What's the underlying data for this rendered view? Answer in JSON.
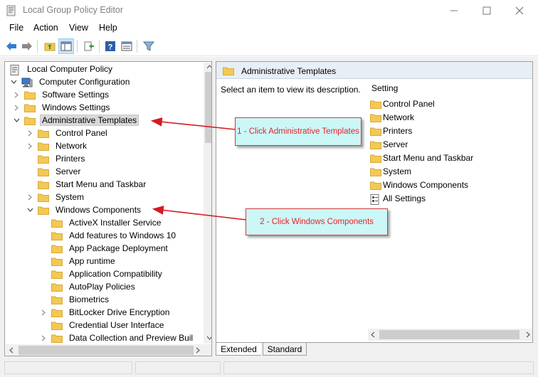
{
  "window": {
    "title": "Local Group Policy Editor",
    "minimize_glyph": "—",
    "maximize_glyph": "☐",
    "close_glyph": "✕"
  },
  "menu": [
    "File",
    "Action",
    "View",
    "Help"
  ],
  "toolbar": {
    "icons": [
      "back-arrow-icon",
      "forward-arrow-icon",
      "up-folder-icon",
      "show-hide-tree-icon",
      "export-list-icon",
      "help-icon",
      "properties-icon",
      "filter-icon"
    ]
  },
  "tree": {
    "items": [
      {
        "label": "Local Computer Policy",
        "level": 0,
        "expander": "",
        "icon": "policy-icon"
      },
      {
        "label": "Computer Configuration",
        "level": 0,
        "expander": "open",
        "icon": "computer-icon"
      },
      {
        "label": "Software Settings",
        "level": 1,
        "expander": "closed",
        "icon": "folder-icon"
      },
      {
        "label": "Windows Settings",
        "level": 1,
        "expander": "closed",
        "icon": "folder-icon"
      },
      {
        "label": "Administrative Templates",
        "level": 1,
        "expander": "open",
        "icon": "folder-icon",
        "selected": true
      },
      {
        "label": "Control Panel",
        "level": 2,
        "expander": "closed",
        "icon": "folder-icon"
      },
      {
        "label": "Network",
        "level": 2,
        "expander": "closed",
        "icon": "folder-icon"
      },
      {
        "label": "Printers",
        "level": 2,
        "expander": "",
        "icon": "folder-icon"
      },
      {
        "label": "Server",
        "level": 2,
        "expander": "",
        "icon": "folder-icon"
      },
      {
        "label": "Start Menu and Taskbar",
        "level": 2,
        "expander": "",
        "icon": "folder-icon"
      },
      {
        "label": "System",
        "level": 2,
        "expander": "closed",
        "icon": "folder-icon"
      },
      {
        "label": "Windows Components",
        "level": 2,
        "expander": "open",
        "icon": "folder-icon"
      },
      {
        "label": "ActiveX Installer Service",
        "level": 3,
        "expander": "",
        "icon": "folder-icon"
      },
      {
        "label": "Add features to Windows 10",
        "level": 3,
        "expander": "",
        "icon": "folder-icon"
      },
      {
        "label": "App Package Deployment",
        "level": 3,
        "expander": "",
        "icon": "folder-icon"
      },
      {
        "label": "App runtime",
        "level": 3,
        "expander": "",
        "icon": "folder-icon"
      },
      {
        "label": "Application Compatibility",
        "level": 3,
        "expander": "",
        "icon": "folder-icon"
      },
      {
        "label": "AutoPlay Policies",
        "level": 3,
        "expander": "",
        "icon": "folder-icon"
      },
      {
        "label": "Biometrics",
        "level": 3,
        "expander": "",
        "icon": "folder-icon"
      },
      {
        "label": "BitLocker Drive Encryption",
        "level": 3,
        "expander": "closed",
        "icon": "folder-icon"
      },
      {
        "label": "Credential User Interface",
        "level": 3,
        "expander": "",
        "icon": "folder-icon"
      },
      {
        "label": "Data Collection and Preview Buil",
        "level": 3,
        "expander": "closed",
        "icon": "folder-icon"
      }
    ]
  },
  "details": {
    "header": "Administrative Templates",
    "description": "Select an item to view its description.",
    "column_header": "Setting",
    "items": [
      {
        "label": "Control Panel",
        "icon": "folder-icon"
      },
      {
        "label": "Network",
        "icon": "folder-icon"
      },
      {
        "label": "Printers",
        "icon": "folder-icon"
      },
      {
        "label": "Server",
        "icon": "folder-icon"
      },
      {
        "label": "Start Menu and Taskbar",
        "icon": "folder-icon"
      },
      {
        "label": "System",
        "icon": "folder-icon"
      },
      {
        "label": "Windows Components",
        "icon": "folder-icon"
      },
      {
        "label": "All Settings",
        "icon": "all-settings-icon"
      }
    ]
  },
  "tabs": [
    "Extended",
    "Standard"
  ],
  "annotations": {
    "callout1": "1 - Click Administrative Templates",
    "callout2": "2 - Click Windows Components",
    "color": "#e8222b"
  },
  "colors": {
    "folder": "#f3c955",
    "folder_dark": "#d9a93a",
    "selection": "#d9d9d9",
    "header_bg": "#e8eef5"
  }
}
